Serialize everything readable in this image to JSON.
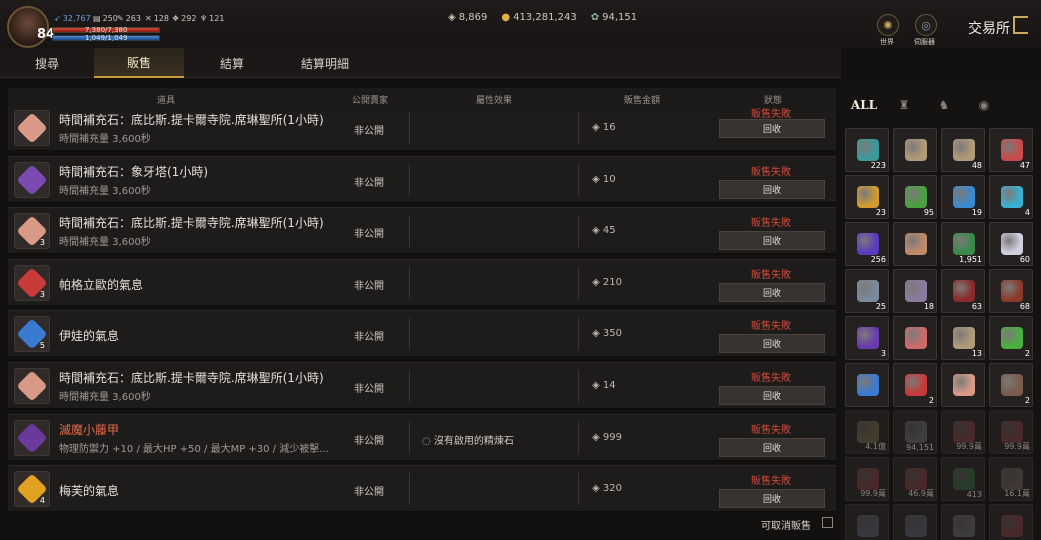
{
  "player": {
    "level": "84",
    "hp_text": "7,380/7,380",
    "mp_text": "1,049/1,049",
    "hp_fraction": 1.0,
    "mp_fraction": 1.0,
    "stats": [
      {
        "icon": "wing-icon",
        "value": "32,767"
      },
      {
        "icon": "scroll-icon",
        "value": "250"
      },
      {
        "icon": "feather-icon",
        "value": "263"
      },
      {
        "icon": "cross-icon",
        "value": "128"
      },
      {
        "icon": "cluster-icon",
        "value": "292"
      },
      {
        "icon": "trophy-icon",
        "value": "121"
      }
    ]
  },
  "currency": [
    {
      "icon": "diamond-icon",
      "value": "8,869"
    },
    {
      "icon": "gold-coin-icon",
      "value": "413,281,243"
    },
    {
      "icon": "silver-coin-icon",
      "value": "94,151"
    }
  ],
  "top_nav": {
    "world_label": "世界",
    "server_label": "伺服器",
    "title": "交易所"
  },
  "tabs": [
    {
      "label": "搜尋",
      "active": false
    },
    {
      "label": "販售",
      "active": true
    },
    {
      "label": "結算",
      "active": false
    },
    {
      "label": "結算明細",
      "active": false
    }
  ],
  "columns": {
    "item": "道具",
    "public": "公開賣家",
    "attr": "屬性效果",
    "price": "販售金額",
    "status": "狀態"
  },
  "rows": [
    {
      "name": "時間補充石：底比斯.提卡爾寺院.席琳聖所(1小時)",
      "sub": "時間補充量 3,600秒",
      "qty": "",
      "public": "非公開",
      "attr": "",
      "price": "16",
      "status": "販售失敗",
      "action": "回收",
      "color": "#d89a86",
      "red_name": false
    },
    {
      "name": "時間補充石：象牙塔(1小時)",
      "sub": "時間補充量 3,600秒",
      "qty": "",
      "public": "非公開",
      "attr": "",
      "price": "10",
      "status": "販售失敗",
      "action": "回收",
      "color": "#7a4ab0",
      "red_name": false
    },
    {
      "name": "時間補充石：底比斯.提卡爾寺院.席琳聖所(1小時)",
      "sub": "時間補充量 3,600秒",
      "qty": "3",
      "public": "非公開",
      "attr": "",
      "price": "45",
      "status": "販售失敗",
      "action": "回收",
      "color": "#d89a86",
      "red_name": false
    },
    {
      "name": "帕格立歐的氣息",
      "sub": "",
      "qty": "3",
      "public": "非公開",
      "attr": "",
      "price": "210",
      "status": "販售失敗",
      "action": "回收",
      "color": "#c83a3a",
      "red_name": false
    },
    {
      "name": "伊娃的氣息",
      "sub": "",
      "qty": "5",
      "public": "非公開",
      "attr": "",
      "price": "350",
      "status": "販售失敗",
      "action": "回收",
      "color": "#3a7ad0",
      "red_name": false
    },
    {
      "name": "時間補充石：底比斯.提卡爾寺院.席琳聖所(1小時)",
      "sub": "時間補充量 3,600秒",
      "qty": "",
      "public": "非公開",
      "attr": "",
      "price": "14",
      "status": "販售失敗",
      "action": "回收",
      "color": "#d89a86",
      "red_name": false
    },
    {
      "name": "滅魔小藤甲",
      "sub": "物理防禦力 +10 / 最大HP +50 / 最大MP +30 / 減少被擊...",
      "qty": "",
      "public": "非公開",
      "attr": "沒有啟用的精煉石",
      "price": "999",
      "status": "販售失敗",
      "action": "回收",
      "color": "#6a3a9a",
      "red_name": true
    },
    {
      "name": "梅芙的氣息",
      "sub": "",
      "qty": "4",
      "public": "非公開",
      "attr": "",
      "price": "320",
      "status": "販售失敗",
      "action": "回收",
      "color": "#e0a020",
      "red_name": false
    }
  ],
  "footer": {
    "cancel_label": "可取消販售"
  },
  "inventory": {
    "tabs": [
      {
        "label": "ALL",
        "icon": "all-icon",
        "active": true
      },
      {
        "label": "",
        "icon": "helmet-icon",
        "active": false
      },
      {
        "label": "",
        "icon": "pouch-icon",
        "active": false
      },
      {
        "label": "",
        "icon": "relic-icon",
        "active": false
      }
    ],
    "items": [
      {
        "count": "223",
        "color": "#3a9a9a",
        "dim": false
      },
      {
        "count": "",
        "color": "#b09a78",
        "dim": false
      },
      {
        "count": "48",
        "color": "#b09a78",
        "dim": false
      },
      {
        "count": "47",
        "color": "#c84a4a",
        "dim": false
      },
      {
        "count": "23",
        "color": "#d09a30",
        "dim": false
      },
      {
        "count": "95",
        "color": "#4aa040",
        "dim": false
      },
      {
        "count": "19",
        "color": "#3a8ad0",
        "dim": false
      },
      {
        "count": "4",
        "color": "#3ab0d0",
        "dim": false
      },
      {
        "count": "256",
        "color": "#5a3ac0",
        "dim": false
      },
      {
        "count": "",
        "color": "#c08a6a",
        "dim": false
      },
      {
        "count": "1,951",
        "color": "#3a8a4a",
        "dim": false
      },
      {
        "count": "60",
        "color": "#d0d0e0",
        "dim": false
      },
      {
        "count": "25",
        "color": "#7a8a9a",
        "dim": false
      },
      {
        "count": "18",
        "color": "#8a7aa0",
        "dim": false
      },
      {
        "count": "63",
        "color": "#8a2a2a",
        "dim": false
      },
      {
        "count": "68",
        "color": "#8a3a2a",
        "dim": false
      },
      {
        "count": "3",
        "color": "#6a3ab0",
        "dim": false
      },
      {
        "count": "",
        "color": "#d06a6a",
        "dim": false
      },
      {
        "count": "13",
        "color": "#b09a78",
        "dim": false
      },
      {
        "count": "2",
        "color": "#4ab040",
        "dim": false
      },
      {
        "count": "",
        "color": "#3a7ad0",
        "dim": false
      },
      {
        "count": "2",
        "color": "#c83a3a",
        "dim": false
      },
      {
        "count": "",
        "color": "#d89a86",
        "dim": false
      },
      {
        "count": "2",
        "color": "#7a5a4a",
        "dim": false
      },
      {
        "count": "4.1億",
        "color": "#b09a60",
        "dim": true
      },
      {
        "count": "94,151",
        "color": "#9aa0a0",
        "dim": true
      },
      {
        "count": "99.9萬",
        "color": "#c04a4a",
        "dim": true
      },
      {
        "count": "99.9萬",
        "color": "#c04a4a",
        "dim": true
      },
      {
        "count": "99.9萬",
        "color": "#c04a4a",
        "dim": true
      },
      {
        "count": "46.9萬",
        "color": "#c04a4a",
        "dim": true
      },
      {
        "count": "413",
        "color": "#3a9a4a",
        "dim": true
      },
      {
        "count": "16.1萬",
        "color": "#a08a7a",
        "dim": true
      },
      {
        "count": "",
        "color": "#7a8aa0",
        "dim": true
      },
      {
        "count": "",
        "color": "#7a8aa0",
        "dim": true
      },
      {
        "count": "",
        "color": "#9a9a9a",
        "dim": true
      },
      {
        "count": "",
        "color": "#c04a4a",
        "dim": true
      }
    ]
  }
}
